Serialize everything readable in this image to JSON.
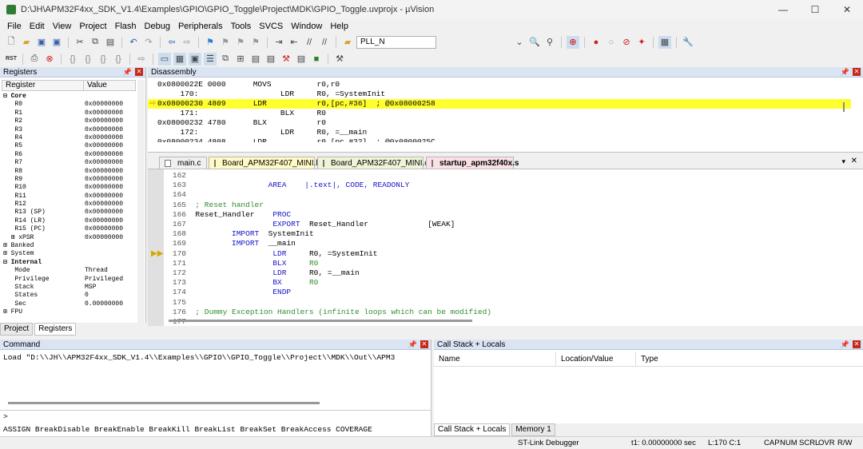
{
  "window": {
    "title": "D:\\JH\\APM32F4xx_SDK_V1.4\\Examples\\GPIO\\GPIO_Toggle\\Project\\MDK\\GPIO_Toggle.uvprojx - µVision",
    "minimize": "—",
    "maximize": "☐",
    "close": "✕"
  },
  "menu": [
    "File",
    "Edit",
    "View",
    "Project",
    "Flash",
    "Debug",
    "Peripherals",
    "Tools",
    "SVCS",
    "Window",
    "Help"
  ],
  "toolbar": {
    "target_combo": "PLL_N",
    "rst_label": "RST"
  },
  "registers": {
    "title": "Registers",
    "col_register": "Register",
    "col_value": "Value",
    "rows": [
      {
        "name": "⊟ Core",
        "value": ""
      },
      {
        "name": "   R0",
        "value": "0x00000000"
      },
      {
        "name": "   R1",
        "value": "0x00000000"
      },
      {
        "name": "   R2",
        "value": "0x00000000"
      },
      {
        "name": "   R3",
        "value": "0x00000000"
      },
      {
        "name": "   R4",
        "value": "0x00000000"
      },
      {
        "name": "   R5",
        "value": "0x00000000"
      },
      {
        "name": "   R6",
        "value": "0x00000000"
      },
      {
        "name": "   R7",
        "value": "0x00000000"
      },
      {
        "name": "   R8",
        "value": "0x00000000"
      },
      {
        "name": "   R9",
        "value": "0x00000000"
      },
      {
        "name": "   R10",
        "value": "0x00000000"
      },
      {
        "name": "   R11",
        "value": "0x00000000"
      },
      {
        "name": "   R12",
        "value": "0x00000000"
      },
      {
        "name": "   R13 (SP)",
        "value": "0x00000000"
      },
      {
        "name": "   R14 (LR)",
        "value": "0x00000000"
      },
      {
        "name": "   R15 (PC)",
        "value": "0x00000000"
      },
      {
        "name": "  ⊞ xPSR",
        "value": "0x00000000"
      },
      {
        "name": "⊞ Banked",
        "value": ""
      },
      {
        "name": "⊞ System",
        "value": ""
      },
      {
        "name": "⊟ Internal",
        "value": ""
      },
      {
        "name": "   Mode",
        "value": "Thread"
      },
      {
        "name": "   Privilege",
        "value": "Privileged"
      },
      {
        "name": "   Stack",
        "value": "MSP"
      },
      {
        "name": "   States",
        "value": "0"
      },
      {
        "name": "   Sec",
        "value": "0.00000000"
      },
      {
        "name": "⊞ FPU",
        "value": ""
      }
    ],
    "tab_project": "Project",
    "tab_registers": "Registers"
  },
  "disassembly": {
    "title": "Disassembly",
    "lines": [
      "0x0800022E 0000      MOVS          r0,r0",
      "     170:                  LDR     R0, =SystemInit",
      "0x08000230 4809      LDR           r0,[pc,#36]  ; @0x08000258",
      "     171:                  BLX     R0",
      "0x08000232 4780      BLX           r0",
      "     172:                  LDR     R0, =__main",
      "0x08000234 4808      LDR           r0,[pc,#32]  ; @0x0800025C"
    ]
  },
  "editor_tabs": [
    {
      "label": "main.c",
      "color": "#f0f0f0"
    },
    {
      "label": "Board_APM32F407_MINI.h",
      "color": "#fff9c4"
    },
    {
      "label": "Board_APM32F407_MINI.c",
      "color": "#eef4d6"
    },
    {
      "label": "startup_apm32f40x.s",
      "color": "#fbe0e6"
    }
  ],
  "editor": {
    "lines": [
      {
        "n": "162",
        "segs": [
          {
            "t": "",
            "c": ""
          }
        ]
      },
      {
        "n": "163",
        "segs": [
          {
            "t": "                AREA    ",
            "c": "kw"
          },
          {
            "t": "|.text|, CODE, READONLY",
            "c": "kw"
          }
        ]
      },
      {
        "n": "164",
        "segs": [
          {
            "t": "",
            "c": ""
          }
        ]
      },
      {
        "n": "165",
        "segs": [
          {
            "t": "; Reset handler",
            "c": "cm"
          }
        ]
      },
      {
        "n": "166",
        "segs": [
          {
            "t": "Reset_Handler    ",
            "c": ""
          },
          {
            "t": "PROC",
            "c": "kw"
          }
        ]
      },
      {
        "n": "167",
        "segs": [
          {
            "t": "                 ",
            "c": ""
          },
          {
            "t": "EXPORT",
            "c": "kw"
          },
          {
            "t": "  Reset_Handler             [WEAK]",
            "c": ""
          }
        ]
      },
      {
        "n": "168",
        "segs": [
          {
            "t": "        ",
            "c": ""
          },
          {
            "t": "IMPORT",
            "c": "kw"
          },
          {
            "t": "  SystemInit",
            "c": ""
          }
        ]
      },
      {
        "n": "169",
        "segs": [
          {
            "t": "        ",
            "c": ""
          },
          {
            "t": "IMPORT",
            "c": "kw"
          },
          {
            "t": "  __main",
            "c": ""
          }
        ]
      },
      {
        "n": "170",
        "segs": [
          {
            "t": "                 ",
            "c": ""
          },
          {
            "t": "LDR",
            "c": "kw"
          },
          {
            "t": "     R0, =SystemInit",
            "c": ""
          }
        ]
      },
      {
        "n": "171",
        "segs": [
          {
            "t": "                 ",
            "c": ""
          },
          {
            "t": "BLX",
            "c": "kw"
          },
          {
            "t": "     ",
            "c": ""
          },
          {
            "t": "R0",
            "c": "cm"
          }
        ]
      },
      {
        "n": "172",
        "segs": [
          {
            "t": "                 ",
            "c": ""
          },
          {
            "t": "LDR",
            "c": "kw"
          },
          {
            "t": "     R0, =__main",
            "c": ""
          }
        ]
      },
      {
        "n": "173",
        "segs": [
          {
            "t": "                 ",
            "c": ""
          },
          {
            "t": "BX",
            "c": "kw"
          },
          {
            "t": "      ",
            "c": ""
          },
          {
            "t": "R0",
            "c": "cm"
          }
        ]
      },
      {
        "n": "174",
        "segs": [
          {
            "t": "                 ",
            "c": ""
          },
          {
            "t": "ENDP",
            "c": "kw"
          }
        ]
      },
      {
        "n": "175",
        "segs": [
          {
            "t": "",
            "c": ""
          }
        ]
      },
      {
        "n": "176",
        "segs": [
          {
            "t": "; Dummy Exception Handlers (infinite loops which can be modified)",
            "c": "cm"
          }
        ]
      },
      {
        "n": "177",
        "segs": [
          {
            "t": "",
            "c": ""
          }
        ]
      }
    ]
  },
  "command": {
    "title": "Command",
    "output": "Load \"D:\\\\JH\\\\APM32F4xx_SDK_V1.4\\\\Examples\\\\GPIO\\\\GPIO_Toggle\\\\Project\\\\MDK\\\\Out\\\\APM3",
    "prompt": ">",
    "hint": "ASSIGN BreakDisable BreakEnable BreakKill BreakList BreakSet BreakAccess COVERAGE"
  },
  "callstack": {
    "title": "Call Stack + Locals",
    "col_name": "Name",
    "col_location": "Location/Value",
    "col_type": "Type",
    "tab_callstack": "Call Stack + Locals",
    "tab_memory": "Memory 1"
  },
  "status": {
    "debugger": "ST-Link Debugger",
    "time": "t1: 0.00000000 sec",
    "position": "L:170 C:1",
    "caps": "CAP",
    "num": "NUM",
    "scrl": "SCRL",
    "ovr": "OVR",
    "rw": "R/W"
  }
}
